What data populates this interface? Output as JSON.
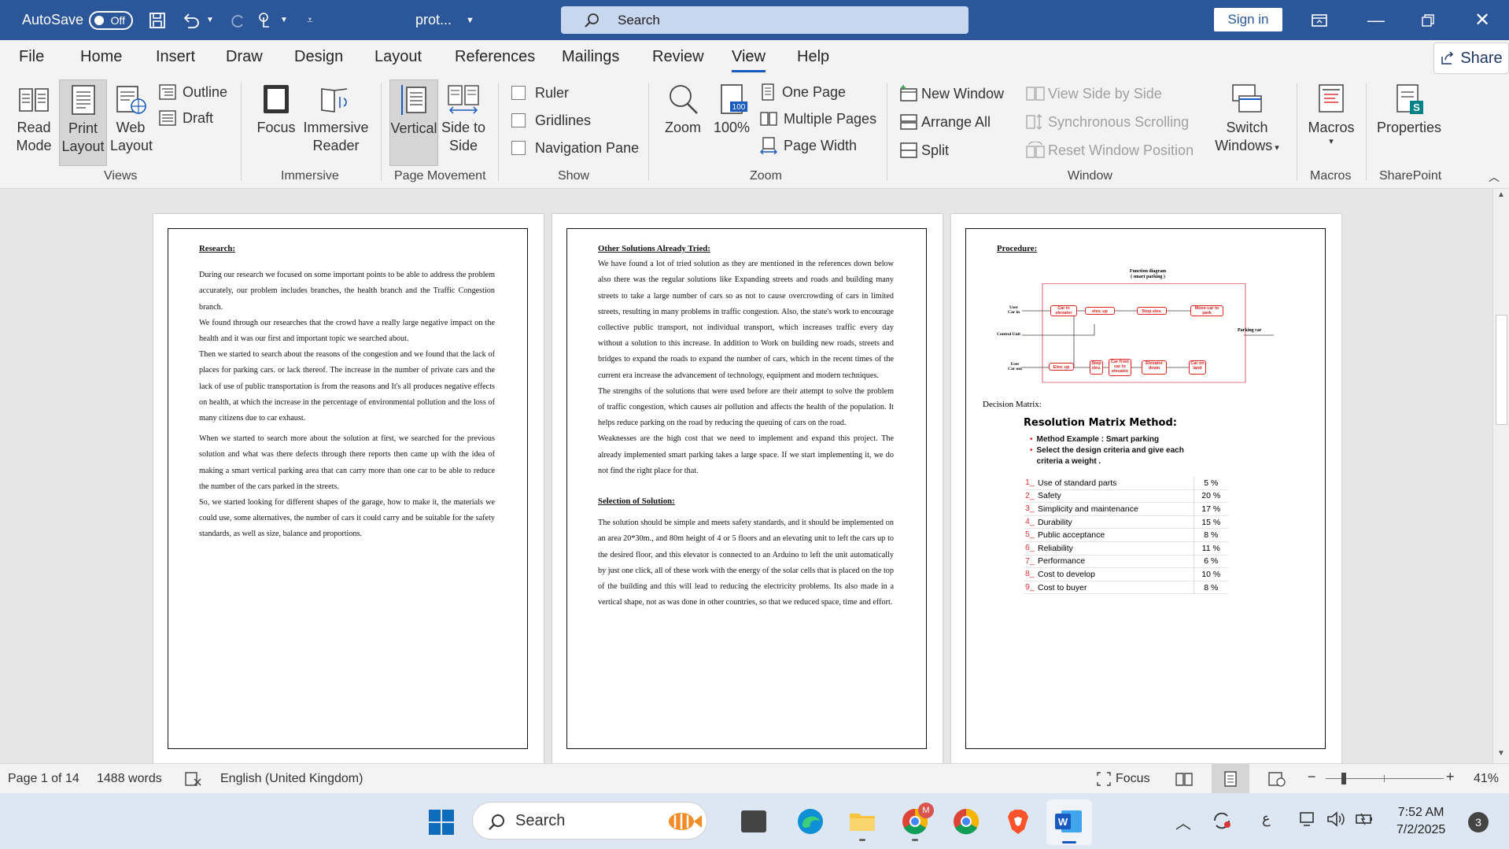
{
  "titlebar": {
    "autosave_label": "AutoSave",
    "autosave_state": "Off",
    "doc_title": "prot...",
    "search_placeholder": "Search",
    "signin_label": "Sign in"
  },
  "tabs": [
    "File",
    "Home",
    "Insert",
    "Draw",
    "Design",
    "Layout",
    "References",
    "Mailings",
    "Review",
    "View",
    "Help"
  ],
  "active_tab": "View",
  "share_label": "Share",
  "ribbon": {
    "views": {
      "read_mode": "Read Mode",
      "print_layout": "Print Layout",
      "web_layout": "Web Layout",
      "outline": "Outline",
      "draft": "Draft",
      "group": "Views"
    },
    "immersive": {
      "focus": "Focus",
      "immersive_reader": "Immersive Reader",
      "group": "Immersive"
    },
    "page_movement": {
      "vertical": "Vertical",
      "side_to_side": "Side to Side",
      "group": "Page Movement"
    },
    "show": {
      "ruler": "Ruler",
      "gridlines": "Gridlines",
      "navigation_pane": "Navigation Pane",
      "group": "Show"
    },
    "zoom": {
      "zoom": "Zoom",
      "percent": "100%",
      "one_page": "One Page",
      "multiple_pages": "Multiple Pages",
      "page_width": "Page Width",
      "group": "Zoom"
    },
    "window": {
      "new_window": "New Window",
      "arrange_all": "Arrange All",
      "split": "Split",
      "view_side_by_side": "View Side by Side",
      "synchronous_scrolling": "Synchronous Scrolling",
      "reset_window_position": "Reset Window Position",
      "switch_windows": "Switch Windows",
      "group": "Window"
    },
    "macros": {
      "macros": "Macros",
      "group": "Macros"
    },
    "sharepoint": {
      "properties": "Properties",
      "group": "SharePoint"
    }
  },
  "page1": {
    "heading": "Research:",
    "p1": "During our research we focused on some important points to be able to address the problem accurately, our problem includes branches, the health branch and the Traffic Congestion branch.",
    "p2": "We found through our researches that the crowd have a really large negative impact on the health and it was our first and important topic we searched about.",
    "p3": "Then we started to search about the reasons of the congestion and we found that the lack of places for parking cars. or lack thereof. The increase in the number of private cars and the lack of use of public transportation is from the reasons and It's all produces negative effects on health, at which the increase in the percentage of environmental pollution and the loss of many citizens due to car exhaust.",
    "p4": "When we started to search more about the solution at first, we searched for the previous solution and what was there defects through there reports then came up with the idea of making a smart vertical parking area that can carry more than one car to be able to reduce the number of the cars parked in the streets.",
    "p5": "So, we started looking for different shapes of the garage, how to make it, the materials we could use, some alternatives, the number of cars it could carry and be suitable for the safety standards, as well as size, balance and proportions."
  },
  "page2": {
    "heading1": "Other Solutions Already Tried:",
    "p1": "We have found a lot of tried solution as they are mentioned in the references down below also there was the regular solutions like Expanding streets and roads and building many streets to take a large number of cars so as not to cause overcrowding of cars in limited streets, resulting in many problems in traffic congestion. Also, the state's work to encourage collective public transport, not individual transport, which increases traffic every day without a solution to this increase. In addition to Work on building new roads, streets and bridges to expand the roads to expand the number of cars, which in the recent times of the current era increase the advancement of technology, equipment and modern techniques.",
    "p2": "The strengths of the solutions that were used before are their attempt to solve the problem of traffic congestion, which causes air pollution and affects the health of the population. It helps reduce parking on the road by reducing the queuing of cars on the road.",
    "p3": "Weaknesses are the high cost that we need to implement and expand this project. The already implemented smart parking takes a large space. If we start implementing it, we do not find the right place for that.",
    "heading2": "Selection of Solution:",
    "p4": "The solution should be simple and meets safety standards, and it should be implemented on an area 20*30m., and 80m height of 4 or 5 floors and an elevating unit to left the cars up to the desired floor, and this elevator is connected to an Arduino to left the unit automatically by just one click, all of these work with the energy of the solar cells that is placed on the top of the building  and this will lead to reducing the electricity problems. Its also made in a vertical shape, not as was done in other countries, so that we reduced space, time and effort."
  },
  "page3": {
    "heading": "Procedure:",
    "diagram_title": "Function diagram",
    "diagram_subtitle": "( smart parking )",
    "diagram": {
      "user_car_in": "User",
      "car_in": "Car in",
      "control_unit": "Control Unit",
      "user_car_out": "User",
      "car_out": "Car out",
      "parking_car": "Parking car",
      "box1": "Car in elevator",
      "box2": "elev. up",
      "box3": "Stop elev.",
      "box4": "Move car to park",
      "box5": "Elev. up",
      "box6": "Stop elev.",
      "box7": "Car from car to elevator",
      "box8": "Elevator down",
      "box9": "Car on land"
    },
    "decision_matrix_label": "Decision Matrix:",
    "matrix_title": "Resolution Matrix Method:",
    "bullet1": "Method Example : Smart parking",
    "bullet2": "Select the design criteria and give each criteria a weight .",
    "criteria": [
      {
        "n": "1_",
        "name": "Use of standard parts",
        "w": "5 %"
      },
      {
        "n": "2_",
        "name": "Safety",
        "w": "20 %"
      },
      {
        "n": "3_",
        "name": "Simplicity and maintenance",
        "w": "17 %"
      },
      {
        "n": "4_",
        "name": "Durability",
        "w": "15 %"
      },
      {
        "n": "5_",
        "name": "Public acceptance",
        "w": "8 %"
      },
      {
        "n": "6_",
        "name": "Reliability",
        "w": "11 %"
      },
      {
        "n": "7_",
        "name": "Performance",
        "w": "6 %"
      },
      {
        "n": "8_",
        "name": "Cost to develop",
        "w": "10 %"
      },
      {
        "n": "9_",
        "name": "Cost to buyer",
        "w": "8 %"
      }
    ]
  },
  "status": {
    "page": "Page 1 of 14",
    "words": "1488 words",
    "language": "English (United Kingdom)",
    "focus": "Focus",
    "zoom": "41%"
  },
  "taskbar": {
    "search": "Search",
    "time": "7:52 AM",
    "date": "7/2/2025",
    "notif_count": "3",
    "lang": "ع",
    "mail_badge": "M"
  }
}
